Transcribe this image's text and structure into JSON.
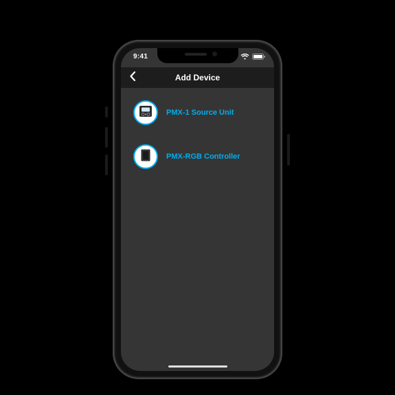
{
  "statusbar": {
    "time": "9:41"
  },
  "navbar": {
    "title": "Add Device"
  },
  "accent": "#00aeef",
  "devices": [
    {
      "label": "PMX-1 Source Unit"
    },
    {
      "label": "PMX-RGB Controller"
    }
  ]
}
